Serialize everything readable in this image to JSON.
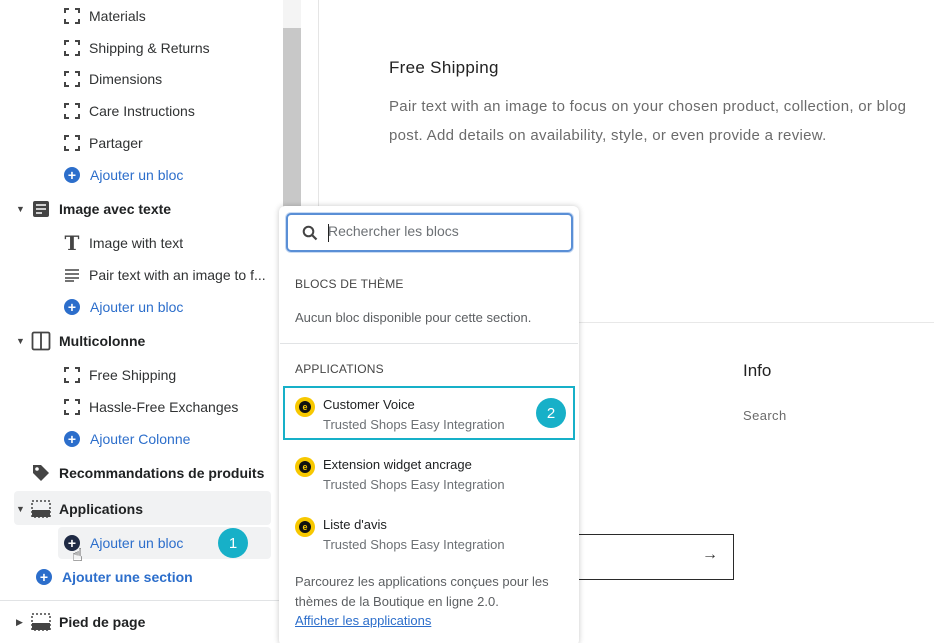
{
  "sidebar": {
    "blocks_top": [
      {
        "label": "Materials",
        "icon": "dashed-square-icon"
      },
      {
        "label": "Shipping & Returns",
        "icon": "dashed-square-icon"
      },
      {
        "label": "Dimensions",
        "icon": "dashed-square-icon"
      },
      {
        "label": "Care Instructions",
        "icon": "dashed-square-icon"
      },
      {
        "label": "Partager",
        "icon": "dashed-square-icon"
      }
    ],
    "add_block_1": "Ajouter un bloc",
    "image_text": {
      "title": "Image avec texte",
      "blocks": [
        "Image with text",
        "Pair text with an image to f..."
      ],
      "add": "Ajouter un bloc"
    },
    "multicolumn": {
      "title": "Multicolonne",
      "blocks": [
        "Free Shipping",
        "Hassle-Free Exchanges"
      ],
      "add": "Ajouter Colonne"
    },
    "recommendations": "Recommandations de produits",
    "applications": {
      "title": "Applications",
      "add": "Ajouter un bloc",
      "badge": "1"
    },
    "add_section": "Ajouter une section",
    "footer": "Pied de page"
  },
  "preview": {
    "title": "Free Shipping",
    "body": "Pair text with an image to focus on your chosen product, collection, or blog post. Add details on availability, style, or even provide a review.",
    "info_heading": "Info",
    "info_link": "Search",
    "arrow": "→"
  },
  "popover": {
    "search_placeholder": "Rechercher les blocs",
    "theme_heading": "BLOCS DE THÈME",
    "theme_empty": "Aucun bloc disponible pour cette section.",
    "apps_heading": "APPLICATIONS",
    "apps": [
      {
        "name": "Customer Voice",
        "vendor": "Trusted Shops Easy Integration"
      },
      {
        "name": "Extension widget ancrage",
        "vendor": "Trusted Shops Easy Integration"
      },
      {
        "name": "Liste d'avis",
        "vendor": "Trusted Shops Easy Integration"
      }
    ],
    "badge": "2",
    "browse_text": "Parcourez les applications conçues pour les thèmes de la Boutique en ligne 2.0.",
    "browse_link": "Afficher les applications"
  },
  "colors": {
    "accent_blue": "#2c6ecb",
    "highlight_teal": "#17b0c8",
    "app_logo_yellow": "#f7c800"
  }
}
